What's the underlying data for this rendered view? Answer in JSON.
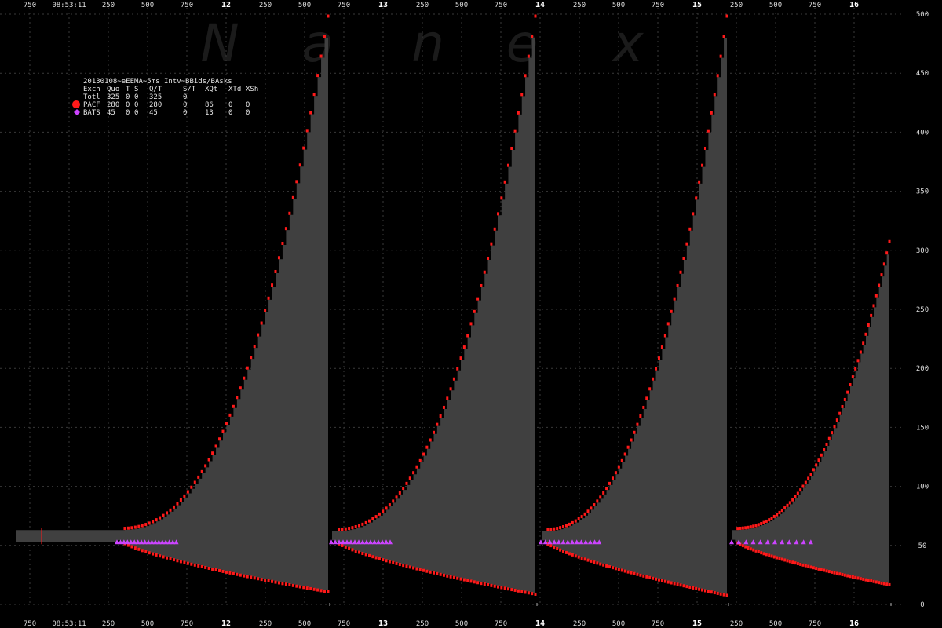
{
  "watermark": [
    "N",
    "a",
    "n",
    "e",
    "x"
  ],
  "chart_data": {
    "type": "area",
    "title": "20130108~eEEMA~5ms Intv~BBids/BAsks",
    "ylim": [
      0,
      500
    ],
    "y_ticks": [
      0,
      50,
      100,
      150,
      200,
      250,
      300,
      350,
      400,
      450,
      500
    ],
    "x_ticks": [
      {
        "label": "750",
        "bold": false
      },
      {
        "label": "08:53:11",
        "bold": false
      },
      {
        "label": "250",
        "bold": false
      },
      {
        "label": "500",
        "bold": false
      },
      {
        "label": "750",
        "bold": false
      },
      {
        "label": "12",
        "bold": true
      },
      {
        "label": "250",
        "bold": false
      },
      {
        "label": "500",
        "bold": false
      },
      {
        "label": "750",
        "bold": false
      },
      {
        "label": "13",
        "bold": true
      },
      {
        "label": "250",
        "bold": false
      },
      {
        "label": "500",
        "bold": false
      },
      {
        "label": "750",
        "bold": false
      },
      {
        "label": "14",
        "bold": true
      },
      {
        "label": "250",
        "bold": false
      },
      {
        "label": "500",
        "bold": false
      },
      {
        "label": "750",
        "bold": false
      },
      {
        "label": "15",
        "bold": true
      },
      {
        "label": "250",
        "bold": false
      },
      {
        "label": "500",
        "bold": false
      },
      {
        "label": "750",
        "bold": false
      },
      {
        "label": "16",
        "bold": true
      }
    ],
    "grid": true,
    "legend_position": "top-left",
    "legend": {
      "header": [
        "Exch",
        "Quo",
        "T",
        "S",
        "Q/T",
        "S/T",
        "XQt",
        "XTd",
        "XSh"
      ],
      "rows": [
        {
          "name": "Totl",
          "cells": [
            "325",
            "0",
            "0",
            "325",
            "0",
            "",
            "",
            ""
          ],
          "color": ""
        },
        {
          "name": "PACF",
          "cells": [
            "280",
            "0",
            "0",
            "280",
            "0",
            "86",
            "0",
            "0"
          ],
          "color": "#ff1a1a",
          "marker": "circle"
        },
        {
          "name": "BATS",
          "cells": [
            "45",
            "0",
            "0",
            "45",
            "0",
            "13",
            "0",
            "0"
          ],
          "color": "#cc44ff",
          "marker": "diamond"
        }
      ]
    },
    "series": [
      {
        "name": "PACF",
        "color": "#ff1a1a"
      },
      {
        "name": "BATS",
        "color": "#cc44ff"
      }
    ],
    "bursts": [
      {
        "bid_start": 57,
        "bid_end": 12,
        "ask_end": 497,
        "base_bid": 53,
        "base_ask": 63
      },
      {
        "bid_start": 57,
        "bid_end": 10,
        "ask_end": 497,
        "base_bid": 53,
        "base_ask": 62
      },
      {
        "bid_start": 57,
        "bid_end": 9,
        "ask_end": 497,
        "base_bid": 53,
        "base_ask": 62
      },
      {
        "bid_start": 57,
        "bid_end": 18,
        "ask_end": 306,
        "base_bid": 53,
        "base_ask": 63
      }
    ],
    "area_color": "#404040"
  }
}
